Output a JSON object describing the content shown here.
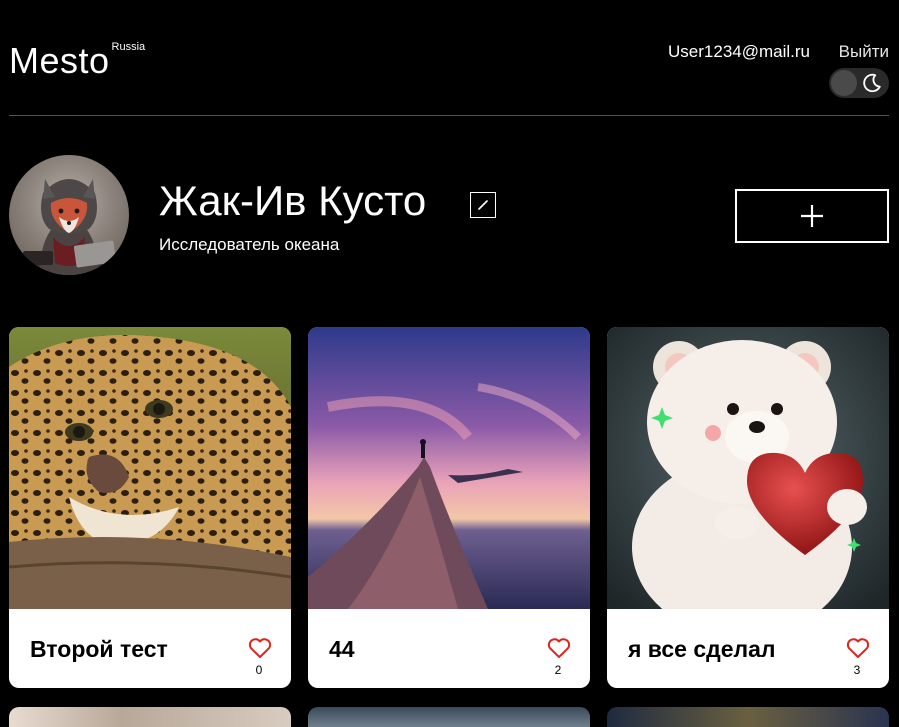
{
  "header": {
    "logo": "Mesto",
    "logo_sup": "Russia",
    "email": "User1234@mail.ru",
    "logout": "Выйти",
    "theme_toggle_icon": "moon-icon"
  },
  "profile": {
    "name": "Жак-Ив Кусто",
    "about": "Исследователь океана",
    "edit_icon": "pencil-icon",
    "add_icon": "plus-icon"
  },
  "cards": [
    {
      "title": "Второй тест",
      "likes": "0",
      "image": "leopard-photo"
    },
    {
      "title": "44",
      "likes": "2",
      "image": "mountain-sunset-photo"
    },
    {
      "title": "я все сделал",
      "likes": "3",
      "image": "bear-with-heart-photo"
    }
  ],
  "colors": {
    "background": "#000000",
    "card": "#ffffff",
    "like": "#e2231a",
    "divider": "#545454"
  }
}
